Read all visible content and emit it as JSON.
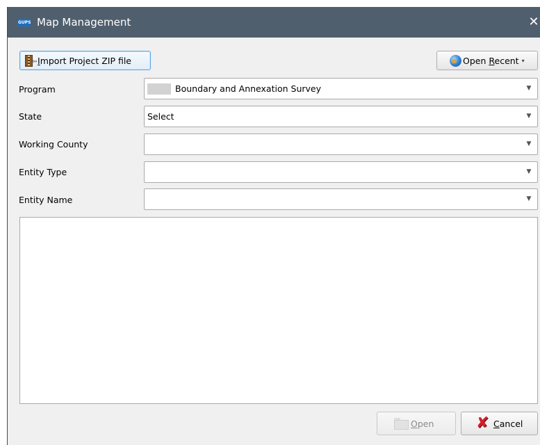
{
  "window": {
    "title": "Map Management",
    "app_icon_text": "GUPS",
    "close_glyph": "✕"
  },
  "toolbar": {
    "import_label_mnemonic": "I",
    "import_label_rest": "mport Project ZIP file",
    "open_recent_label_prefix": "Open ",
    "open_recent_mnemonic": "R",
    "open_recent_label_rest": "ecent",
    "open_recent_caret": "▾"
  },
  "form": {
    "program": {
      "label": "Program",
      "value": "Boundary and Annexation Survey"
    },
    "state": {
      "label": "State",
      "value": "Select"
    },
    "working_county": {
      "label": "Working County",
      "value": ""
    },
    "entity_type": {
      "label": "Entity Type",
      "value": ""
    },
    "entity_name": {
      "label": "Entity Name",
      "value": ""
    },
    "dropdown_arrow": "▼"
  },
  "footer": {
    "open_mnemonic": "O",
    "open_rest": "pen",
    "open_enabled": false,
    "cancel_mnemonic": "C",
    "cancel_rest": "ancel"
  },
  "icons": {
    "import": "zip-archive-icon",
    "open_recent": "globe-icon",
    "open": "folder-icon",
    "cancel": "red-x-icon",
    "close": "close-icon"
  },
  "colors": {
    "titlebar": "#505f6e",
    "dialog_bg": "#f0f0f0",
    "focus_border": "#5aa7e6",
    "cancel_x": "#d0202a"
  }
}
